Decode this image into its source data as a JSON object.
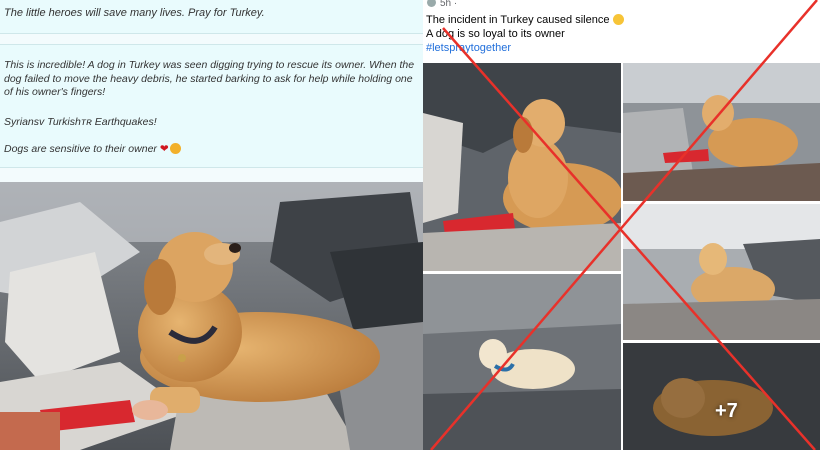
{
  "left_post": {
    "top_line": "The little heroes will save many lives. Pray for Turkey.",
    "paragraph": "This is incredible! A dog in Turkey was seen digging trying to rescue its owner. When the dog failed to move the heavy debris, he started barking to ask for help while holding one of his owner's fingers!",
    "tag_line": "Syriansᴠ Turkishᴛʀ Earthquakes!",
    "closing": "Dogs are sensitive to their owner"
  },
  "right_post": {
    "meta": "5h ·",
    "caption_1": "The incident in Turkey caused silence",
    "caption_2": "A dog is so loyal to its owner",
    "hashtag": "#letspraytogether",
    "more_count": "+7"
  },
  "colors": {
    "cross": "#e8312a",
    "link": "#216fdb",
    "text_panel": "#e9fbfd"
  },
  "icons": [
    "heart-icon",
    "smile-emoji-icon",
    "face-emoji-icon",
    "red-cross-mark-icon"
  ]
}
